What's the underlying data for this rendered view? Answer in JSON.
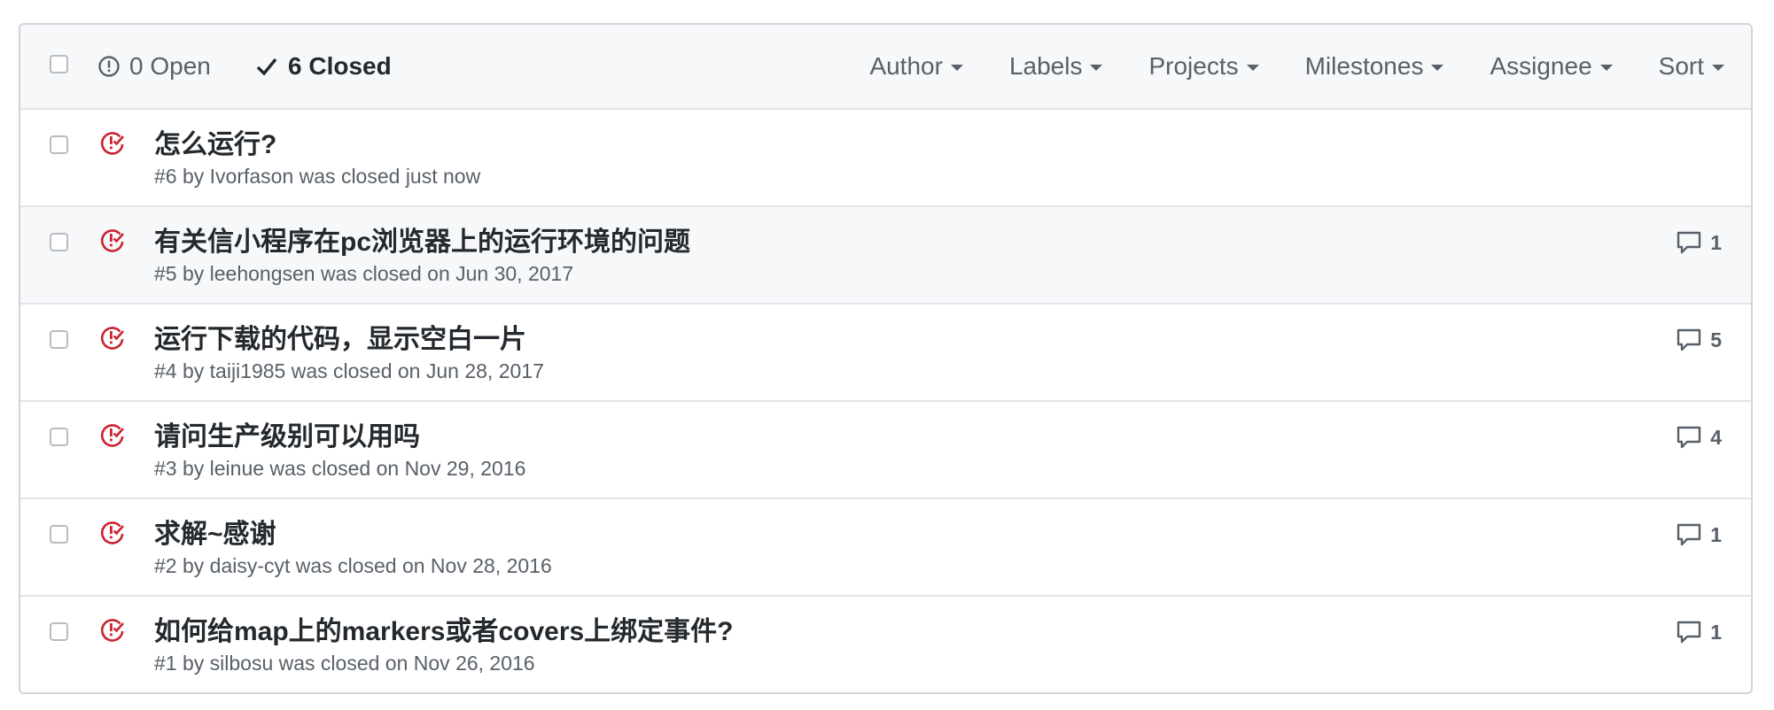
{
  "header": {
    "open_label": "0 Open",
    "closed_label": "6 Closed",
    "filters": [
      {
        "label": "Author"
      },
      {
        "label": "Labels"
      },
      {
        "label": "Projects"
      },
      {
        "label": "Milestones"
      },
      {
        "label": "Assignee"
      },
      {
        "label": "Sort"
      }
    ]
  },
  "issues": [
    {
      "title": "怎么运行?",
      "meta": "#6 by Ivorfason was closed just now",
      "comments": ""
    },
    {
      "title": "有关信小程序在pc浏览器上的运行环境的问题",
      "meta": "#5 by leehongsen was closed on Jun 30, 2017",
      "comments": "1"
    },
    {
      "title": "运行下载的代码，显示空白一片",
      "meta": "#4 by taiji1985 was closed on Jun 28, 2017",
      "comments": "5"
    },
    {
      "title": "请问生产级别可以用吗",
      "meta": "#3 by leinue was closed on Nov 29, 2016",
      "comments": "4"
    },
    {
      "title": "求解~感谢",
      "meta": "#2 by daisy-cyt was closed on Nov 28, 2016",
      "comments": "1"
    },
    {
      "title": "如何给map上的markers或者covers上绑定事件?",
      "meta": "#1 by silbosu was closed on Nov 26, 2016",
      "comments": "1"
    }
  ],
  "colors": {
    "closed_icon": "#cb2431",
    "header_bg": "#f6f8fa",
    "border": "#e1e4e8"
  },
  "icons": {
    "open_state": "issue-opened-icon",
    "closed_state": "check-icon",
    "issue_closed": "issue-closed-icon",
    "comment": "comment-icon"
  }
}
